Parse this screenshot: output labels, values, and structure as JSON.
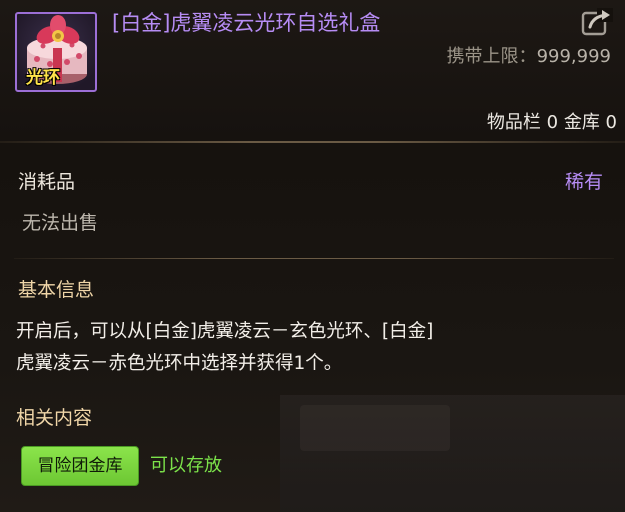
{
  "item": {
    "title": "[白金]虎翼凌云光环自选礼盒",
    "icon_tag": "光环",
    "icon_name": "gift-box-icon",
    "border_color": "#9c6fd6",
    "title_color": "#b68cf4"
  },
  "carry_limit": {
    "label": "携带上限：",
    "value": "999,999"
  },
  "storage_counts": "物品栏 0 金库 0",
  "category": {
    "label": "消耗品",
    "rarity": "稀有",
    "rarity_color": "#b68cf4",
    "sell_status": "无法出售"
  },
  "basic_info": {
    "title": "基本信息",
    "lines": [
      "开启后，可以从[白金]虎翼凌云－玄色光环、[白金]",
      "虎翼凌云－赤色光环中选择并获得1个。"
    ]
  },
  "related": {
    "title": "相关内容",
    "storage_badge": "冒险团金库",
    "storage_status": "可以存放",
    "status_color": "#7ce24a"
  },
  "share_icon": "share-export-icon"
}
